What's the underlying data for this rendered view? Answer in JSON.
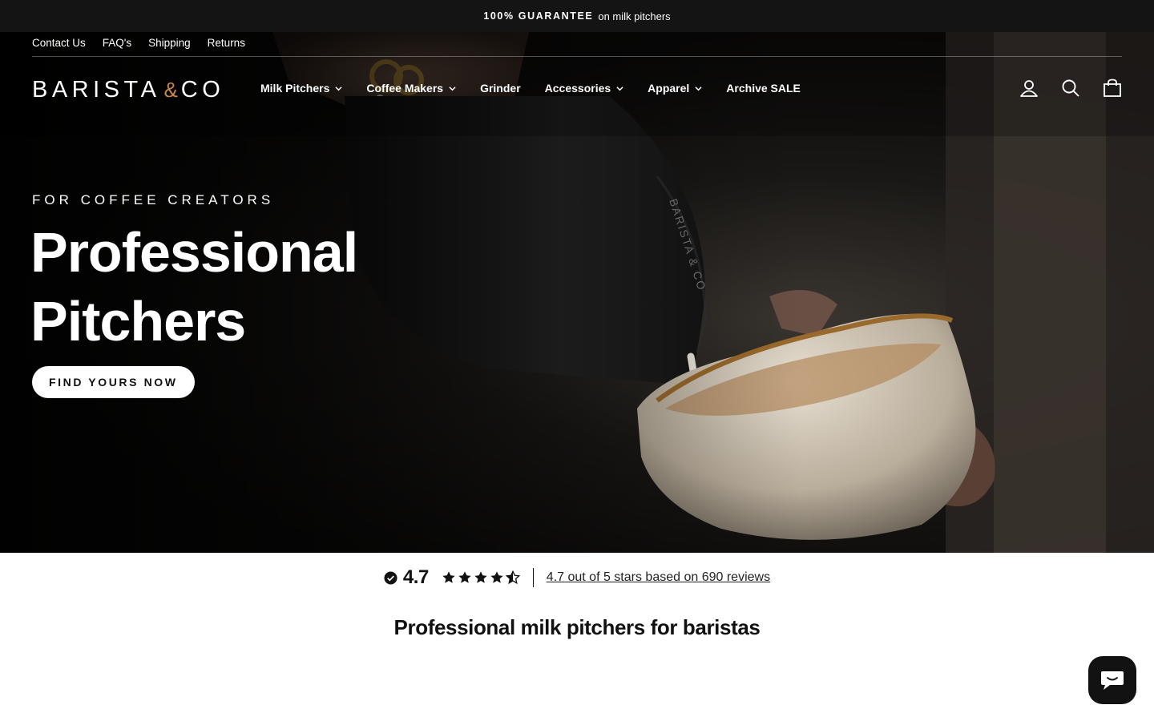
{
  "announcement": {
    "bold": "100% GUARANTEE",
    "rest": "on milk pitchers"
  },
  "utility_links": [
    "Contact Us",
    "FAQ's",
    "Shipping",
    "Returns"
  ],
  "logo": {
    "left": "BARISTA",
    "amp": "&",
    "right": "CO"
  },
  "nav": [
    {
      "label": "Milk Pitchers",
      "dropdown": true
    },
    {
      "label": "Coffee Makers",
      "dropdown": true
    },
    {
      "label": "Grinder",
      "dropdown": false
    },
    {
      "label": "Accessories",
      "dropdown": true
    },
    {
      "label": "Apparel",
      "dropdown": true
    },
    {
      "label": "Archive SALE",
      "dropdown": false
    }
  ],
  "header_icons": [
    "account-icon",
    "search-icon",
    "cart-icon"
  ],
  "hero": {
    "eyebrow": "FOR COFFEE CREATORS",
    "headline_line1": "Professional",
    "headline_line2": "Pitchers",
    "cta": "FIND YOURS NOW"
  },
  "reviews": {
    "score": "4.7",
    "rating": 4.7,
    "max": 5,
    "link_text": "4.7 out of 5 stars based on 690 reviews"
  },
  "section_title": "Professional milk pitchers for baristas",
  "colors": {
    "announcement_bg": "#141414",
    "logo_accent": "#c8874a",
    "chat_bg": "#121212"
  }
}
